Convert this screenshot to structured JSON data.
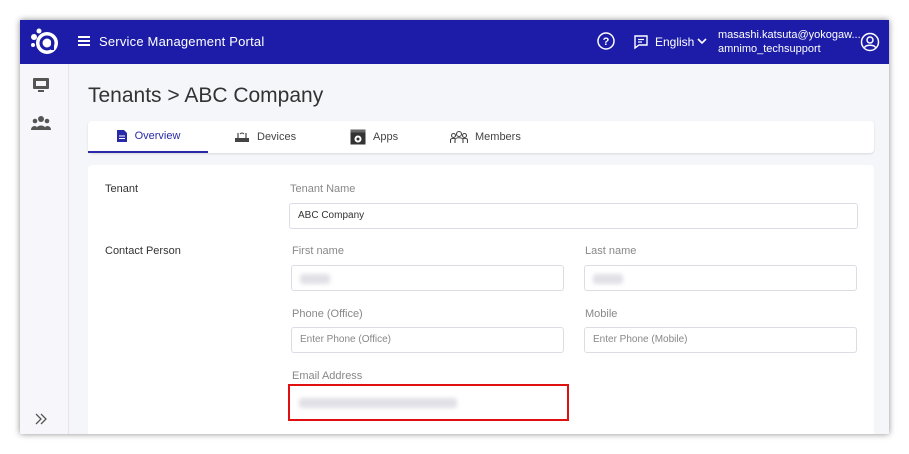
{
  "topbar": {
    "title": "Service Management Portal",
    "language": "English",
    "user_email": "masashi.katsuta@yokogaw...",
    "user_org": "amnimo_techsupport"
  },
  "breadcrumb": "Tenants > ABC Company",
  "tabs": [
    {
      "label": "Overview",
      "icon": "document-icon",
      "active": true
    },
    {
      "label": "Devices",
      "icon": "router-icon",
      "active": false
    },
    {
      "label": "Apps",
      "icon": "apps-icon",
      "active": false
    },
    {
      "label": "Members",
      "icon": "members-icon",
      "active": false
    }
  ],
  "form": {
    "tenant_section": "Tenant",
    "tenant_name_label": "Tenant Name",
    "tenant_name_value": "ABC Company",
    "contact_section": "Contact Person",
    "first_name_label": "First name",
    "last_name_label": "Last name",
    "phone_label": "Phone (Office)",
    "phone_placeholder": "Enter Phone (Office)",
    "mobile_label": "Mobile",
    "mobile_placeholder": "Enter Phone (Mobile)",
    "email_label": "Email Address"
  },
  "colors": {
    "accent": "#1c1ca8",
    "highlight": "#e01010"
  }
}
